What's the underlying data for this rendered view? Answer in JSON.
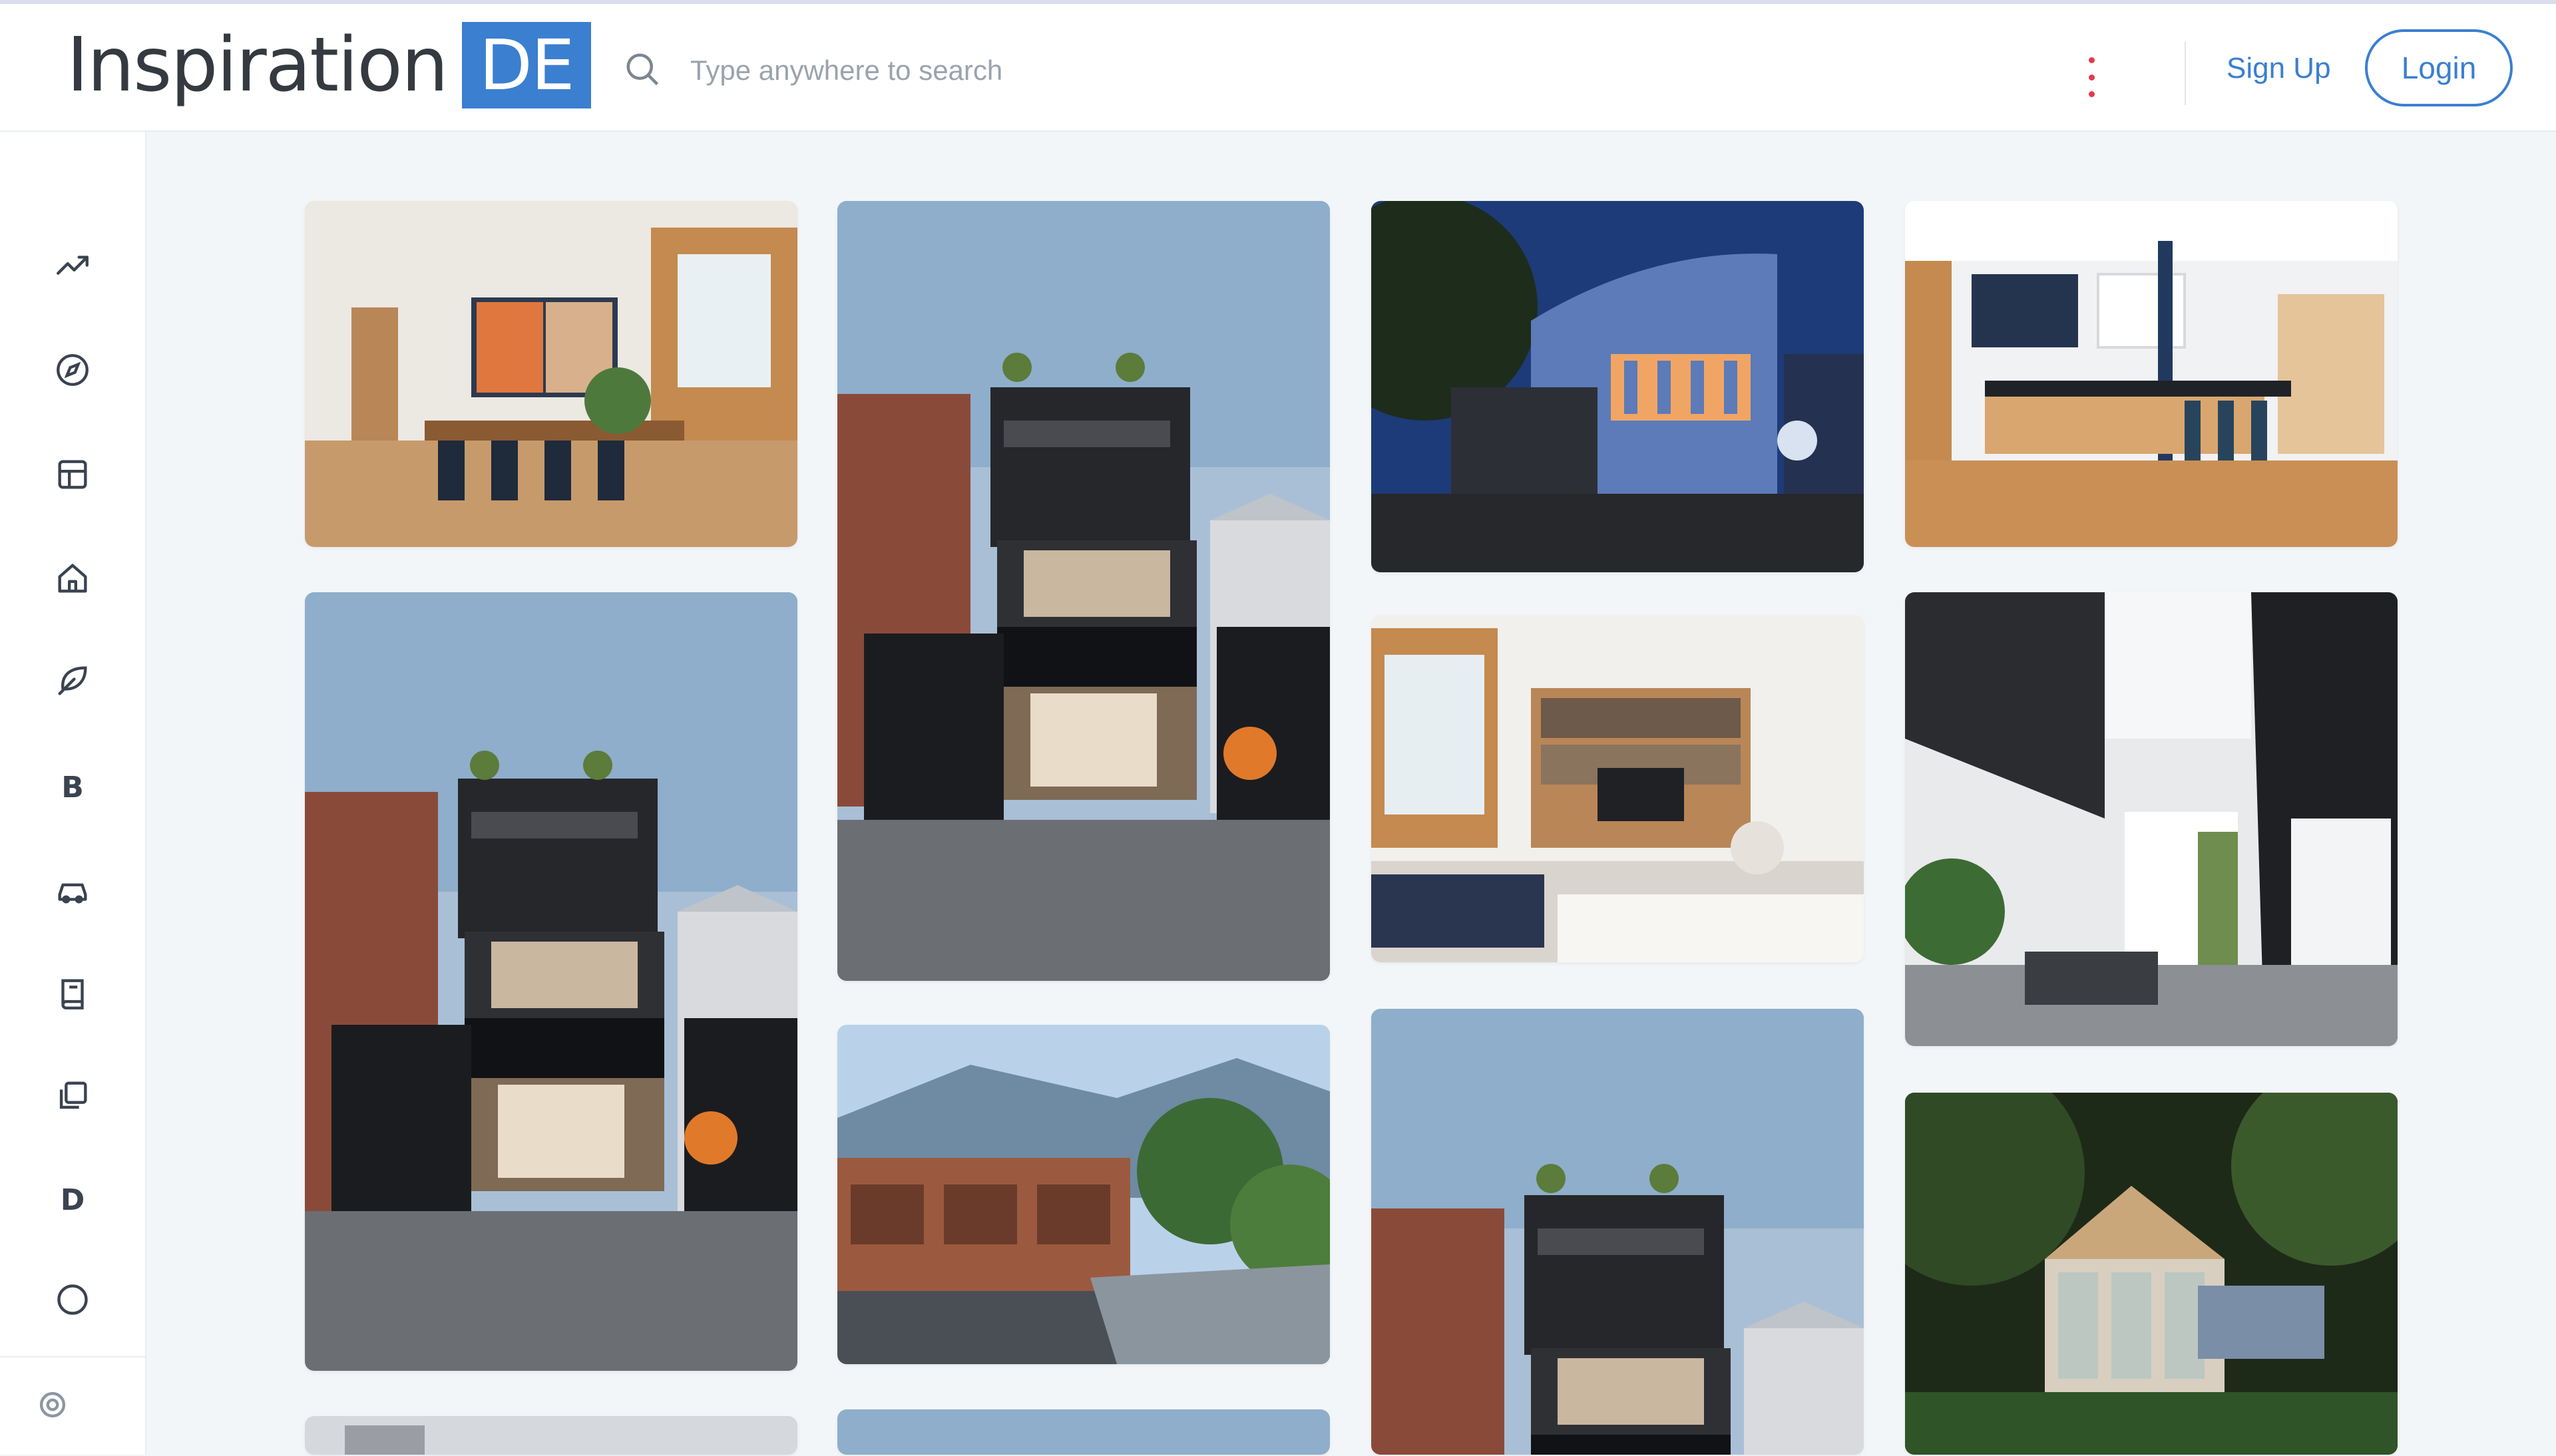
{
  "app": {
    "logo_text": "Inspiration",
    "logo_badge": "DE",
    "brand_color": "#3b7fd0",
    "accent_dot_color": "#e23a4e"
  },
  "header": {
    "search_placeholder": "Type anywhere to search",
    "signup_label": "Sign Up",
    "login_label": "Login"
  },
  "sidebar": {
    "items": [
      {
        "name": "trending-icon"
      },
      {
        "name": "compass-icon"
      },
      {
        "name": "layout-icon"
      },
      {
        "name": "home-icon"
      },
      {
        "name": "leaf-icon"
      },
      {
        "name": "letter-b",
        "letter": "B"
      },
      {
        "name": "car-icon"
      },
      {
        "name": "book-icon"
      },
      {
        "name": "stack-icon"
      },
      {
        "name": "letter-d",
        "letter": "D"
      },
      {
        "name": "circle-icon"
      }
    ],
    "bottom_icon": "settings-icon"
  },
  "gallery": {
    "images": [
      {
        "name": "dining-room"
      },
      {
        "name": "black-narrow-house-tall"
      },
      {
        "name": "blue-curved-building-night"
      },
      {
        "name": "modern-kitchen"
      },
      {
        "name": "black-narrow-house"
      },
      {
        "name": "living-room-bookshelves"
      },
      {
        "name": "white-corridor-interior"
      },
      {
        "name": "brick-village-river"
      },
      {
        "name": "black-narrow-house-3"
      },
      {
        "name": "garden-greenhouse"
      },
      {
        "name": "partial-image-1"
      },
      {
        "name": "partial-image-2"
      }
    ]
  }
}
